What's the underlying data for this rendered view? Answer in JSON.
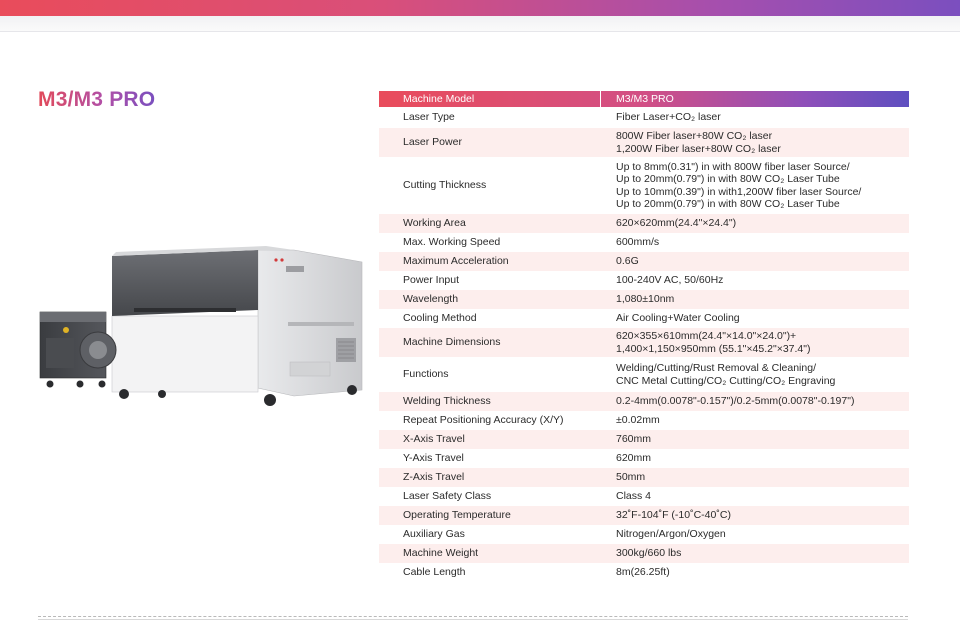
{
  "page": {
    "title": "M3/M3 PRO",
    "colors": {
      "accent_start": "#e94c5b",
      "accent_mid": "#b24fa6",
      "accent_end": "#5e4fc0",
      "row_shade": "#fdeeed"
    }
  },
  "specs": {
    "header": {
      "label": "Machine Model",
      "value": "M3/M3 PRO"
    },
    "rows": [
      {
        "label": "Laser Type",
        "lines": [
          "Fiber Laser+CO₂ laser"
        ]
      },
      {
        "label": "Laser Power",
        "lines": [
          "800W Fiber laser+80W CO₂ laser",
          "1,200W Fiber laser+80W CO₂ laser"
        ]
      },
      {
        "label": "Cutting Thickness",
        "lines": [
          "Up to 8mm(0.31\") in with 800W fiber laser Source/",
          "Up to 20mm(0.79\") in with 80W CO₂ Laser Tube",
          "Up to 10mm(0.39\") in with1,200W fiber laser Source/",
          "Up to 20mm(0.79\") in with 80W CO₂ Laser Tube"
        ]
      },
      {
        "label": "Working Area",
        "lines": [
          "620×620mm(24.4\"×24.4\")"
        ]
      },
      {
        "label": "Max. Working Speed",
        "lines": [
          "600mm/s"
        ]
      },
      {
        "label": "Maximum Acceleration",
        "lines": [
          "0.6G"
        ]
      },
      {
        "label": "Power Input",
        "lines": [
          "100-240V AC, 50/60Hz"
        ]
      },
      {
        "label": "Wavelength",
        "lines": [
          "1,080±10nm"
        ]
      },
      {
        "label": "Cooling Method",
        "lines": [
          "Air Cooling+Water Cooling"
        ]
      },
      {
        "label": "Machine Dimensions",
        "lines": [
          "620×355×610mm(24.4\"×14.0\"×24.0\")+",
          "1,400×1,150×950mm (55.1\"×45.2\"×37.4\")"
        ]
      },
      {
        "label": "Functions",
        "lines": [
          "Welding/Cutting/Rust Removal & Cleaning/",
          "CNC Metal Cutting/CO₂ Cutting/CO₂ Engraving"
        ]
      },
      {
        "label": "Welding Thickness",
        "lines": [
          "0.2-4mm(0.0078\"-0.157\")/0.2-5mm(0.0078\"-0.197\")"
        ]
      },
      {
        "label": "Repeat Positioning Accuracy (X/Y)",
        "lines": [
          "±0.02mm"
        ]
      },
      {
        "label": "X-Axis Travel",
        "lines": [
          "760mm"
        ]
      },
      {
        "label": "Y-Axis Travel",
        "lines": [
          "620mm"
        ]
      },
      {
        "label": "Z-Axis Travel",
        "lines": [
          "50mm"
        ]
      },
      {
        "label": "Laser Safety Class",
        "lines": [
          "Class 4"
        ]
      },
      {
        "label": "Operating Temperature",
        "lines": [
          "32˚F-104˚F (-10˚C-40˚C)"
        ]
      },
      {
        "label": "Auxiliary Gas",
        "lines": [
          "Nitrogen/Argon/Oxygen"
        ]
      },
      {
        "label": "Machine Weight",
        "lines": [
          "300kg/660 lbs"
        ]
      },
      {
        "label": "Cable Length",
        "lines": [
          "8m(26.25ft)"
        ]
      }
    ]
  }
}
